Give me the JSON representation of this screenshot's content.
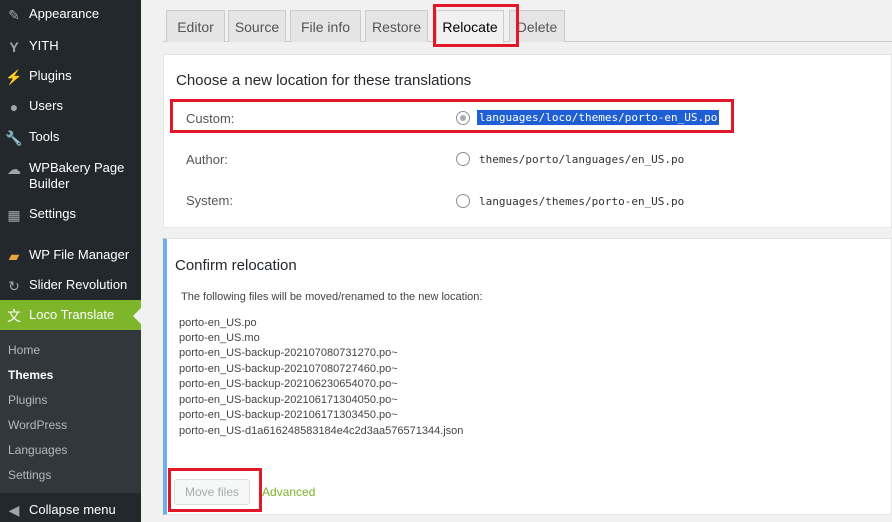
{
  "sidebar": {
    "items": [
      {
        "label": "Appearance",
        "icon": "brush-icon"
      },
      {
        "label": "YITH",
        "icon": "yith-icon"
      },
      {
        "label": "Plugins",
        "icon": "plugin-icon"
      },
      {
        "label": "Users",
        "icon": "user-icon"
      },
      {
        "label": "Tools",
        "icon": "wrench-icon"
      },
      {
        "label": "WPBakery Page Builder",
        "icon": "wpbakery-icon"
      },
      {
        "label": "Settings",
        "icon": "settings-icon"
      },
      {
        "label": "WP File Manager",
        "icon": "file-manager-icon"
      },
      {
        "label": "Slider Revolution",
        "icon": "slider-icon"
      },
      {
        "label": "Loco Translate",
        "icon": "loco-icon"
      }
    ],
    "submenu": [
      {
        "label": "Home"
      },
      {
        "label": "Themes"
      },
      {
        "label": "Plugins"
      },
      {
        "label": "WordPress"
      },
      {
        "label": "Languages"
      },
      {
        "label": "Settings"
      }
    ],
    "collapse_label": "Collapse menu"
  },
  "tabs": [
    {
      "label": "Editor"
    },
    {
      "label": "Source"
    },
    {
      "label": "File info"
    },
    {
      "label": "Restore"
    },
    {
      "label": "Relocate"
    },
    {
      "label": "Delete"
    }
  ],
  "active_tab": "Relocate",
  "location": {
    "title": "Choose a new location for these translations",
    "options": [
      {
        "label": "Custom:",
        "path": "languages/loco/themes/porto-en_US.po",
        "checked": true
      },
      {
        "label": "Author:",
        "path": "themes/porto/languages/en_US.po",
        "checked": false
      },
      {
        "label": "System:",
        "path": "languages/themes/porto-en_US.po",
        "checked": false
      }
    ]
  },
  "confirm": {
    "title": "Confirm relocation",
    "description": "The following files will be moved/renamed to the new location:",
    "files": [
      "porto-en_US.po",
      "porto-en_US.mo",
      "porto-en_US-backup-202107080731270.po~",
      "porto-en_US-backup-202107080727460.po~",
      "porto-en_US-backup-202106230654070.po~",
      "porto-en_US-backup-202106171304050.po~",
      "porto-en_US-backup-202106171303450.po~",
      "porto-en_US-d1a616248583184e4c2d3aa576571344.json"
    ],
    "move_button": "Move files",
    "advanced_link": "Advanced"
  },
  "colors": {
    "accent_green": "#7db52b",
    "highlight_red": "#e2172a",
    "sidebar_bg": "#23282d",
    "selection_blue": "#1e5fd6"
  }
}
